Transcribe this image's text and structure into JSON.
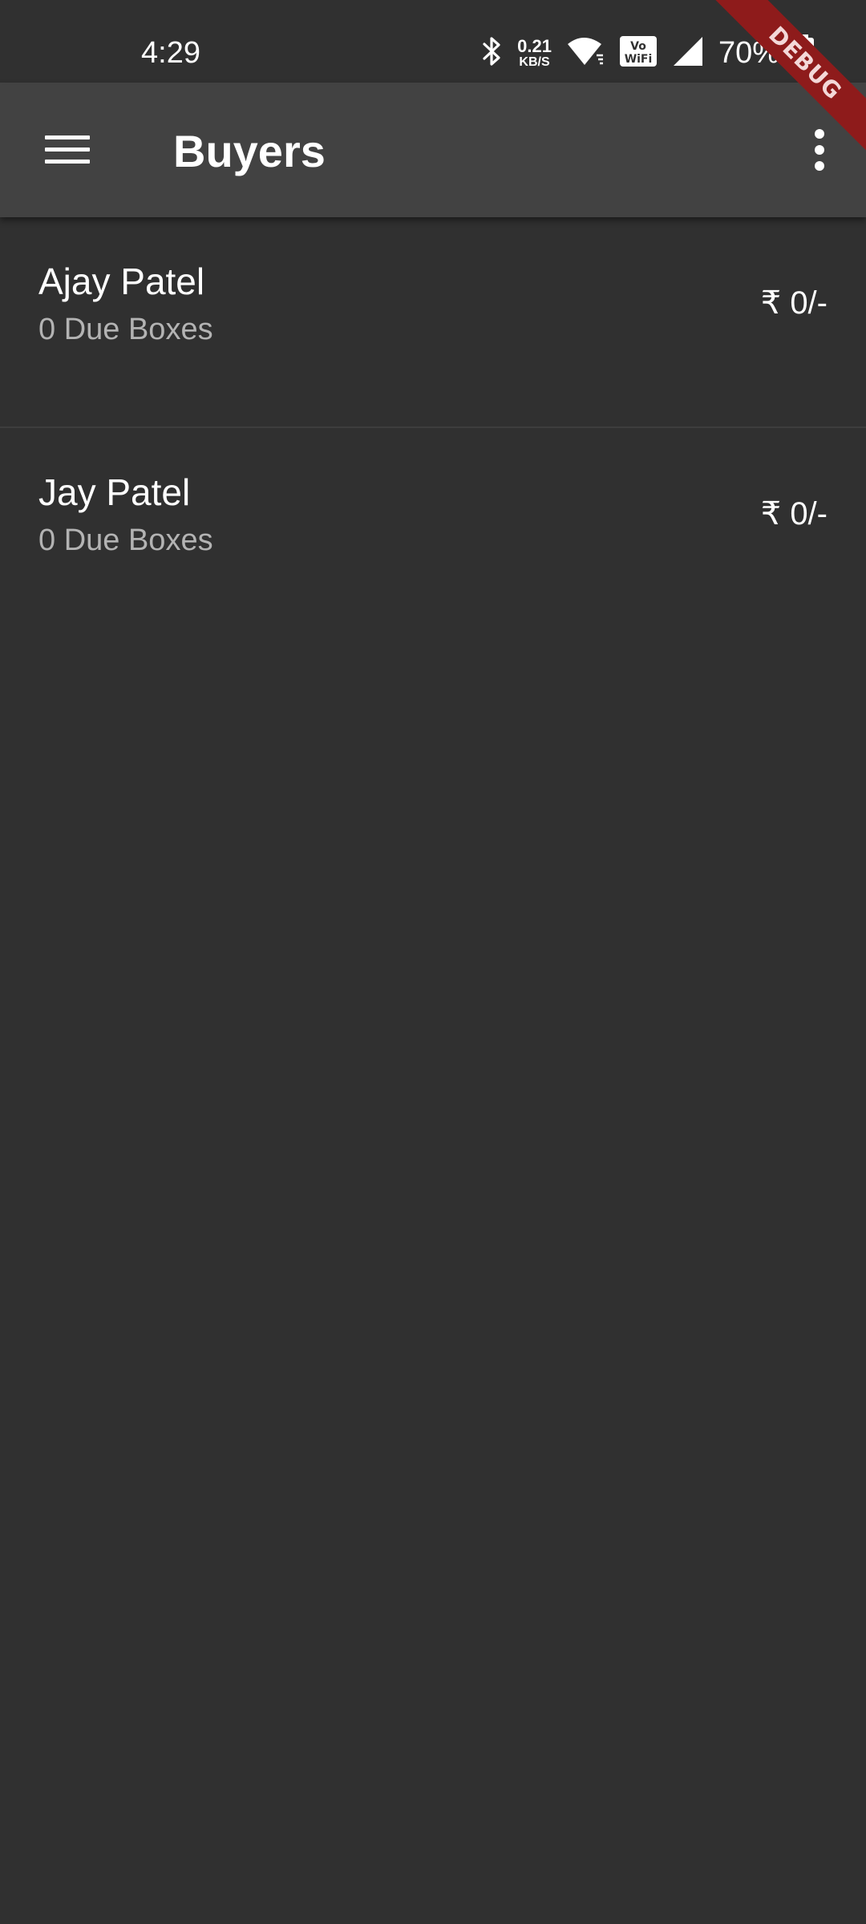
{
  "status_bar": {
    "time": "4:29",
    "net_speed_value": "0.21",
    "net_speed_unit": "KB/S",
    "battery_percent": "70%",
    "icons": [
      "bluetooth-icon",
      "wifi-icon",
      "vowifi-icon",
      "signal-icon",
      "battery-icon"
    ]
  },
  "app_bar": {
    "title": "Buyers",
    "menu_icon": "menu-icon",
    "more_icon": "more-vert-icon"
  },
  "buyers": [
    {
      "name": "Ajay Patel",
      "due": "0 Due Boxes",
      "amount": "₹ 0/-"
    },
    {
      "name": "Jay Patel",
      "due": "0 Due Boxes",
      "amount": "₹ 0/-"
    }
  ],
  "debug_banner": {
    "label": "DEBUG"
  },
  "colors": {
    "background": "#303030",
    "app_bar": "#424242",
    "secondary_text": "#b3b3b3",
    "debug_ribbon": "#8e1b1b"
  }
}
